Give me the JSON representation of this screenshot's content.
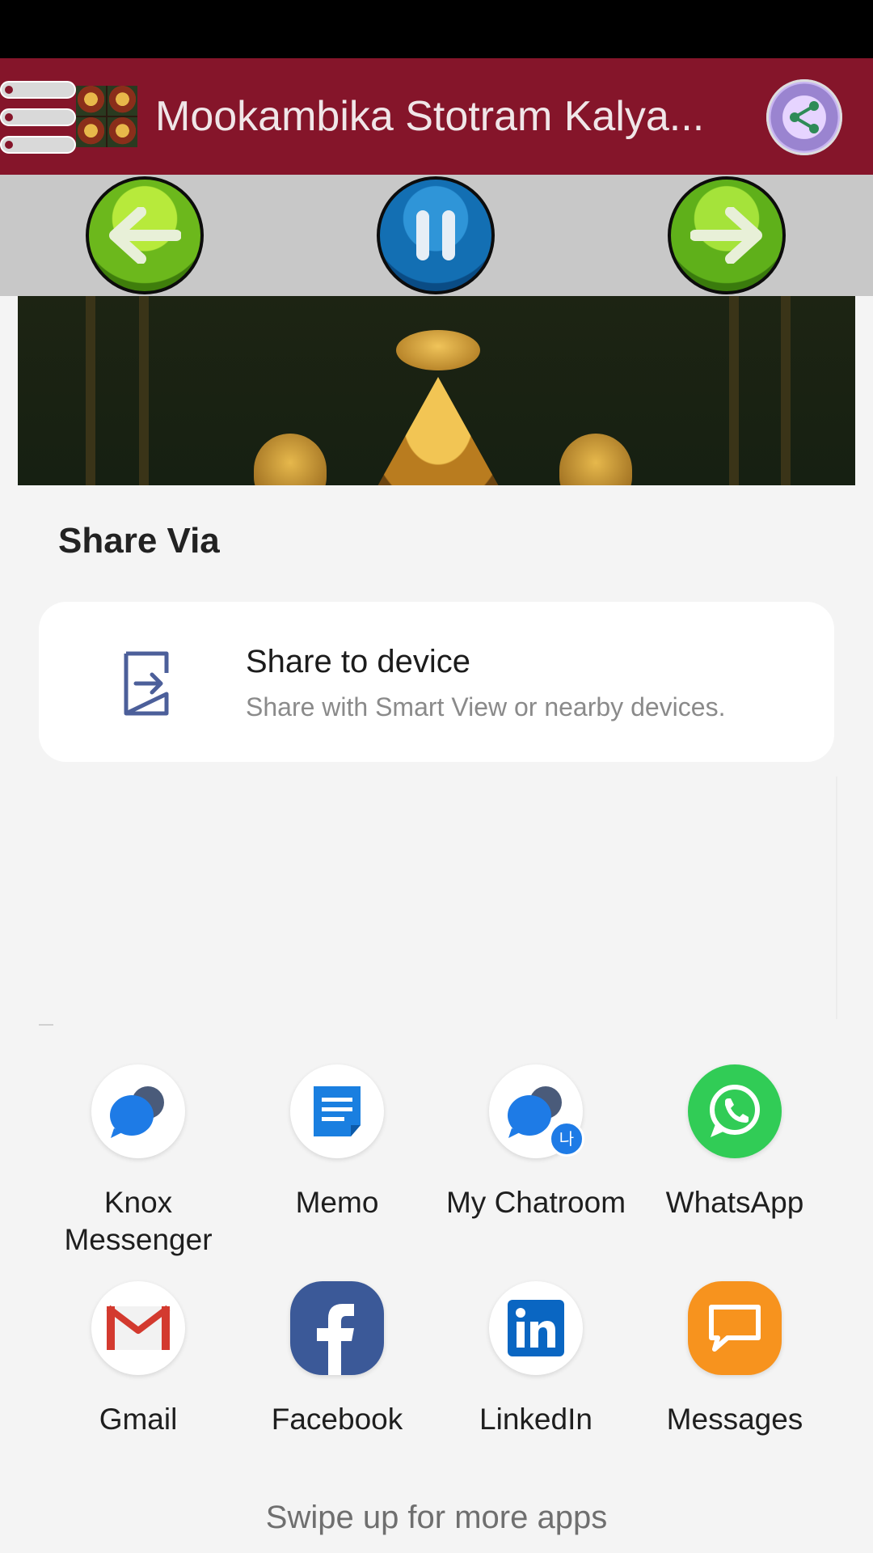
{
  "app": {
    "title": "Mookambika Stotram Kalya...",
    "menu_icon": "hamburger-menu-icon",
    "share_icon": "share-icon",
    "controls": [
      {
        "name": "previous",
        "icon": "arrow-left-icon"
      },
      {
        "name": "pause",
        "icon": "pause-icon"
      },
      {
        "name": "next",
        "icon": "arrow-right-icon"
      }
    ],
    "colors": {
      "app_bar": "#85152a",
      "prev_next": "#6cb81c",
      "pause": "#136fb3"
    }
  },
  "share_sheet": {
    "title": "Share Via",
    "share_to_device": {
      "title": "Share to device",
      "subtitle": "Share with Smart View or nearby devices.",
      "icon": "share-to-device-icon"
    },
    "apps": [
      {
        "label": "Knox Messenger",
        "line1": "Knox",
        "line2": "Messenger",
        "icon": "knox-messenger-icon"
      },
      {
        "label": "Memo",
        "icon": "memo-icon"
      },
      {
        "label": "My Chatroom",
        "icon": "my-chatroom-icon",
        "badge": "나"
      },
      {
        "label": "WhatsApp",
        "icon": "whatsapp-icon",
        "color": "#31cc56"
      },
      {
        "label": "Gmail",
        "icon": "gmail-icon",
        "color": "#d33a2f"
      },
      {
        "label": "Facebook",
        "icon": "facebook-icon",
        "color": "#3b5998"
      },
      {
        "label": "LinkedIn",
        "icon": "linkedin-icon",
        "color": "#0a66c2"
      },
      {
        "label": "Messages",
        "icon": "messages-icon",
        "color": "#f7931e"
      }
    ],
    "swipe_hint": "Swipe up for more apps"
  }
}
